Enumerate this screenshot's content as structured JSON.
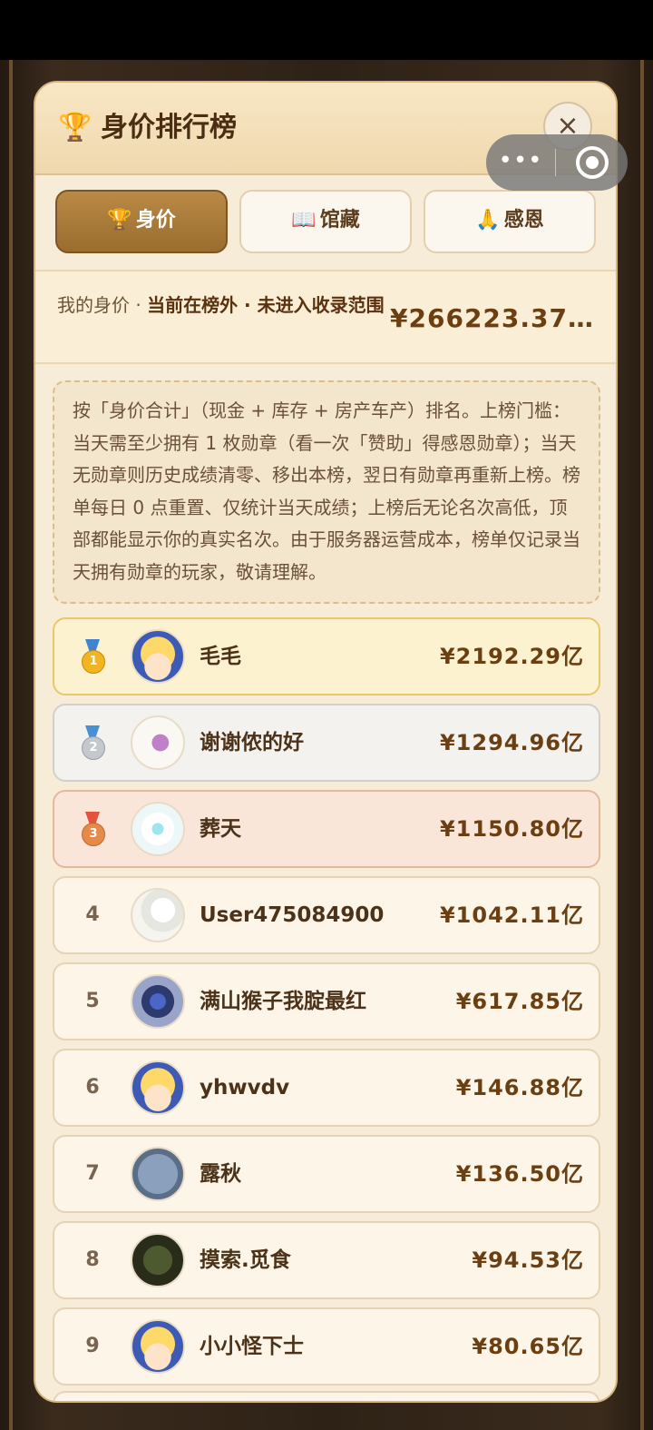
{
  "header": {
    "title": "身价排行榜",
    "title_icon": "trophy-icon",
    "close_label": "×"
  },
  "capsule": {
    "more_label": "•••"
  },
  "tabs": [
    {
      "icon": "🏆",
      "label": "身价"
    },
    {
      "icon": "📖",
      "label": "馆藏"
    },
    {
      "icon": "🙏",
      "label": "感恩"
    }
  ],
  "my_status": {
    "label": "我的身价 · ",
    "state": "当前在榜外 · 未进入收录范围",
    "value": "¥266223.37…"
  },
  "rules_text": "按「身价合计」（现金 + 库存 + 房产车产）排名。上榜门槛：当天需至少拥有 1 枚勋章（看一次「赞助」得感恩勋章）；当天无勋章则历史成绩清零、移出本榜，翌日有勋章再重新上榜。榜单每日 0 点重置、仅统计当天成绩；上榜后无论名次高低，顶部都能显示你的真实名次。由于服务器运营成本，榜单仅记录当天拥有勋章的玩家，敬请理解。",
  "leaderboard": [
    {
      "rank": "1",
      "name": "毛毛",
      "value": "¥2192.29亿",
      "medal": "gold"
    },
    {
      "rank": "2",
      "name": "谢谢侬的好",
      "value": "¥1294.96亿",
      "medal": "silver"
    },
    {
      "rank": "3",
      "name": "葬天",
      "value": "¥1150.80亿",
      "medal": "bronze"
    },
    {
      "rank": "4",
      "name": "User475084900",
      "value": "¥1042.11亿"
    },
    {
      "rank": "5",
      "name": "满山猴子我腚最红",
      "value": "¥617.85亿"
    },
    {
      "rank": "6",
      "name": "yhwvdv",
      "value": "¥146.88亿"
    },
    {
      "rank": "7",
      "name": "露秋",
      "value": "¥136.50亿"
    },
    {
      "rank": "8",
      "name": "摸索.觅食",
      "value": "¥94.53亿"
    },
    {
      "rank": "9",
      "name": "小小怪下士",
      "value": "¥80.65亿"
    }
  ]
}
